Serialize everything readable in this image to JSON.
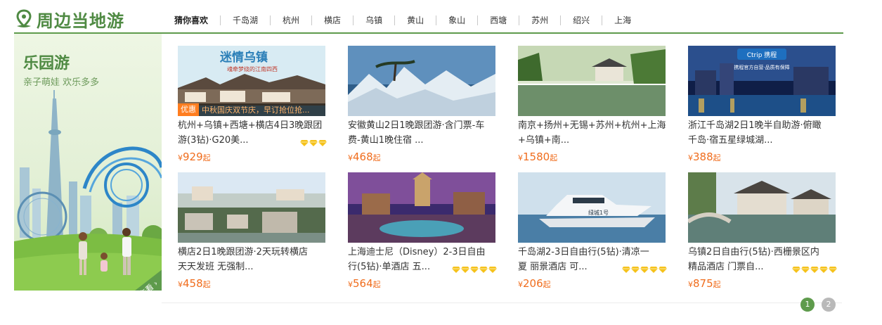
{
  "header": {
    "logo_text": "周边当地游",
    "tabs": [
      {
        "label": "猜你喜欢",
        "active": true
      },
      {
        "label": "千岛湖"
      },
      {
        "label": "杭州"
      },
      {
        "label": "横店"
      },
      {
        "label": "乌镇"
      },
      {
        "label": "黄山"
      },
      {
        "label": "象山"
      },
      {
        "label": "西塘"
      },
      {
        "label": "苏州"
      },
      {
        "label": "绍兴"
      },
      {
        "label": "上海"
      }
    ]
  },
  "promo": {
    "title": "乐园游",
    "subtitle": "亲子萌娃 欢乐多多",
    "more": "查看 ›"
  },
  "products": [
    {
      "title1": "杭州+乌镇+西塘+横店4日3晚跟团",
      "title2": "游(3钻)·G20美...",
      "price_currency": "¥",
      "price": "929",
      "price_suffix": "起",
      "diamonds": 3,
      "thumb_text": "迷情乌镇",
      "thumb_sub": "魂牵梦绕的江南四西",
      "badge": "优惠",
      "promo_text": "中秋国庆双节庆，早订抢位抢..."
    },
    {
      "title1": "安徽黄山2日1晚跟团游·含门票-车",
      "title2": "费-黄山1晚住宿 ...",
      "price_currency": "¥",
      "price": "468",
      "price_suffix": "起",
      "diamonds": 0
    },
    {
      "title1": "南京+扬州+无锡+苏州+杭州+上海",
      "title2": "+乌镇+南...",
      "price_currency": "¥",
      "price": "1580",
      "price_suffix": "起",
      "diamonds": 0
    },
    {
      "title1": "浙江千岛湖2日1晚半自助游·俯瞰",
      "title2": "千岛·宿五星绿城湖...",
      "price_currency": "¥",
      "price": "388",
      "price_suffix": "起",
      "diamonds": 0,
      "thumb_logo": "Ctrip 携程",
      "thumb_sub": "携程官方自营·品质有保障"
    },
    {
      "title1": "横店2日1晚跟团游·2天玩转横店",
      "title2": "天天发班 无强制...",
      "price_currency": "¥",
      "price": "458",
      "price_suffix": "起",
      "diamonds": 0
    },
    {
      "title1": "上海迪士尼（Disney）2-3日自由",
      "title2": "行(5钻)·单酒店 五...",
      "price_currency": "¥",
      "price": "564",
      "price_suffix": "起",
      "diamonds": 5
    },
    {
      "title1": "千岛湖2-3日自由行(5钻)·清凉一",
      "title2": "夏 丽景酒店 可...",
      "price_currency": "¥",
      "price": "206",
      "price_suffix": "起",
      "diamonds": 5,
      "thumb_text": "绿城1号"
    },
    {
      "title1": "乌镇2日自由行(5钻)·西栅景区内",
      "title2": "精品酒店 门票自...",
      "price_currency": "¥",
      "price": "875",
      "price_suffix": "起",
      "diamonds": 5
    }
  ],
  "pager": {
    "pages": [
      "1",
      "2"
    ],
    "current": 0
  },
  "colors": {
    "brand_green": "#5e9b4c",
    "price_orange": "#f06d1d",
    "diamond_gold": "#f5c21b"
  }
}
